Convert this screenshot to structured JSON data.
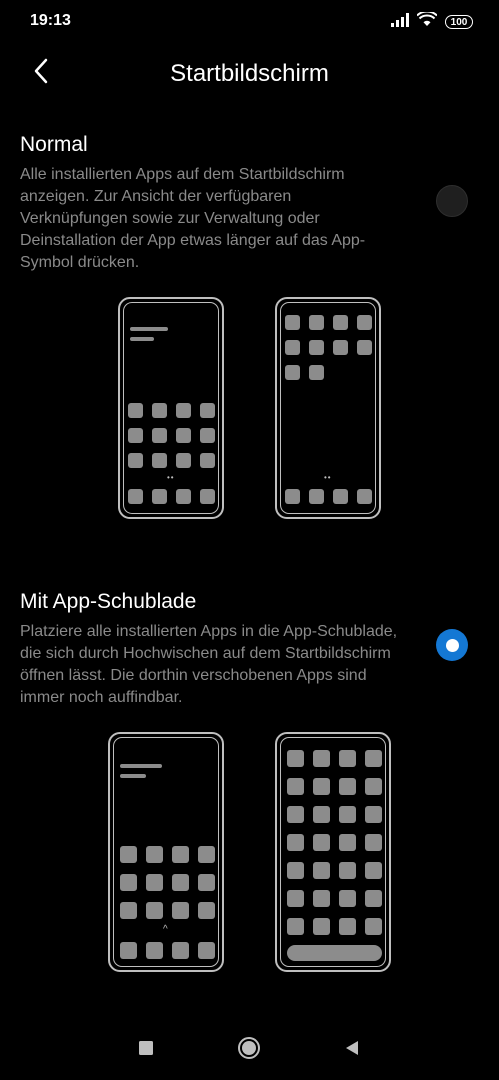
{
  "status_bar": {
    "time": "19:13",
    "battery": "100",
    "icons": [
      "signal-icon",
      "wifi-icon",
      "battery-icon"
    ]
  },
  "header": {
    "title": "Startbildschirm",
    "back_icon": "chevron-left-icon"
  },
  "options": [
    {
      "title": "Normal",
      "description": "Alle installierten Apps auf dem Startbildschirm anzeigen. Zur Ansicht der verfügbaren Verknüpfungen sowie zur Verwaltung oder Deinstallation der App etwas länger auf das App-Symbol drücken.",
      "selected": false
    },
    {
      "title": "Mit App-Schublade",
      "description": "Platziere alle installierten Apps in die App-Schublade, die sich durch Hochwischen auf dem Startbildschirm öffnen lässt. Die dorthin verschobenen Apps sind immer noch auffindbar.",
      "selected": true
    }
  ],
  "colors": {
    "background": "#000000",
    "accent": "#1478d4",
    "secondary_text": "#8a8a8a",
    "illustration": "#8c8c8c"
  },
  "navbar": {
    "icons": [
      "recents-square-icon",
      "home-circle-icon",
      "back-triangle-icon"
    ]
  }
}
